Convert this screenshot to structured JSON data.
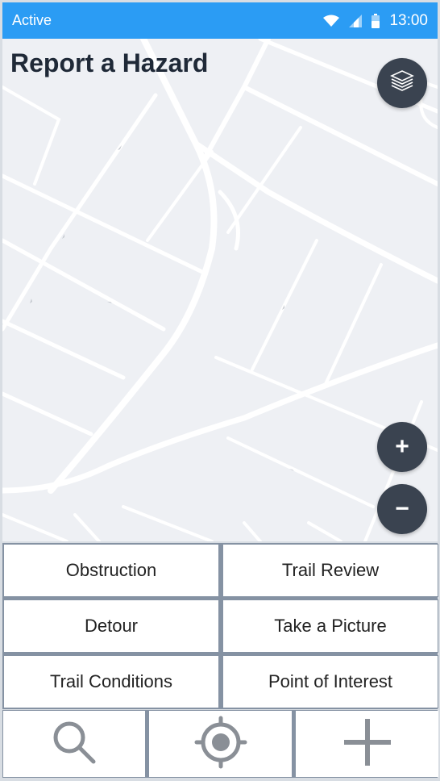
{
  "status_bar": {
    "label": "Active",
    "time": "13:00",
    "color": "#2b9cf4",
    "icons": [
      "wifi-icon",
      "signal-icon",
      "battery-icon"
    ]
  },
  "map": {
    "title": "Report a Hazard",
    "controls": {
      "layers_icon": "layers-icon",
      "zoom_in": "+",
      "zoom_out": "−"
    }
  },
  "hazard_options": [
    {
      "label": "Obstruction"
    },
    {
      "label": "Trail Review"
    },
    {
      "label": "Detour"
    },
    {
      "label": "Take a Picture"
    },
    {
      "label": "Trail Conditions"
    },
    {
      "label": "Point of Interest"
    }
  ],
  "bottom_bar": {
    "icons": [
      "search-icon",
      "locate-icon",
      "add-icon"
    ],
    "icon_color": "#8a8f96"
  }
}
